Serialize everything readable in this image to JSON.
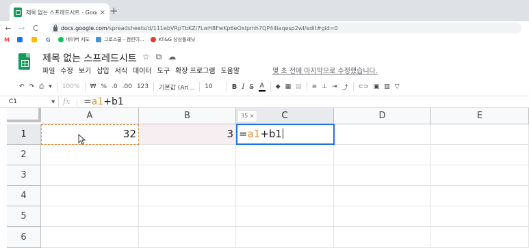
{
  "browser": {
    "tab_title": "제목 없는 스프레드시트 - Goog",
    "tab_close": "×",
    "new_tab": "+",
    "back": "←",
    "forward": "→",
    "reload": "C",
    "home": "⌂",
    "url_host": "docs.google.com",
    "url_path": "/spreadsheets/d/111ebVRpTbKZi7LwH8FwKp6eOxIpmh7QP44iaqesp2wI/edit#gid=0"
  },
  "bookmarks": [
    {
      "label": "M",
      "color": "#ea4335",
      "letter": true
    },
    {
      "label": "",
      "color": "#1a73e8",
      "letter": false
    },
    {
      "label": "",
      "color": "#fbbc04",
      "letter": false
    },
    {
      "label": "G",
      "color": "#4285f4",
      "letter": true
    },
    {
      "label": "네이버 지도",
      "color": "#03c75a",
      "letter": false
    },
    {
      "label": "그로스쿨 - 컴린이...",
      "color": "#4a90d9",
      "letter": false
    },
    {
      "label": "KT&G 상상플래닛",
      "color": "#e53935",
      "letter": false
    }
  ],
  "sheets": {
    "title": "제목 없는 스프레드시트",
    "star_icon": "☆",
    "folder_icon": "⧉",
    "cloud_icon": "☁",
    "menu": [
      "파일",
      "수정",
      "보기",
      "삽입",
      "서식",
      "데이터",
      "도구",
      "확장 프로그램",
      "도움말"
    ],
    "last_edit": "몇 초 전에 마지막으로 수정했습니다."
  },
  "toolbar": {
    "undo": "↶",
    "redo": "↷",
    "print": "⎙",
    "paint": "▾",
    "zoom": "100%",
    "currency": "₩",
    "percent": "%",
    "dec_less": ".0",
    "dec_more": ".00",
    "format_123": "123",
    "font": "기본값 (Ari...",
    "size": "10",
    "bold": "B",
    "italic": "I",
    "strike": "S",
    "text_color": "A"
  },
  "formula_bar": {
    "cell_ref": "C1",
    "fx": "fx",
    "formula_eq": "=",
    "formula_ref_a": "a1",
    "formula_plus": "+",
    "formula_ref_b": "b1"
  },
  "grid": {
    "columns": [
      "A",
      "B",
      "C",
      "D",
      "E"
    ],
    "rows": [
      "1",
      "2",
      "3",
      "4",
      "5",
      "6"
    ],
    "size_chip": "35 ×",
    "cells": {
      "A1": "32",
      "B1": "3",
      "C1_eq": "=",
      "C1_ref_a": "a1",
      "C1_plus": "+",
      "C1_ref_b": "b1"
    }
  },
  "colors": {
    "accent_blue": "#1a73e8",
    "sheets_green": "#0f9d58",
    "ref_orange": "#e69138",
    "ref_b_tint": "#f7eef2"
  }
}
